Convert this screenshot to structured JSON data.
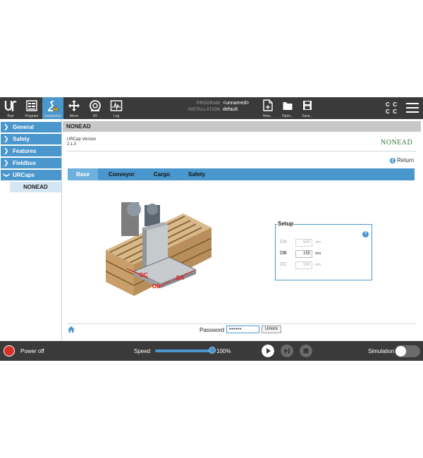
{
  "header": {
    "nav": [
      {
        "label": "Run",
        "icon": "ur-logo-icon"
      },
      {
        "label": "Program",
        "icon": "program-icon"
      },
      {
        "label": "Installation",
        "icon": "installation-icon",
        "active": true
      },
      {
        "label": "Move",
        "icon": "move-icon"
      },
      {
        "label": "I/O",
        "icon": "io-icon"
      },
      {
        "label": "Log",
        "icon": "log-icon"
      }
    ],
    "program_key": "PROGRAM",
    "program_value": "<unnamed>",
    "installation_key": "INSTALLATION",
    "installation_value": "default",
    "file_buttons": [
      {
        "label": "New...",
        "icon": "new-file-icon"
      },
      {
        "label": "Open...",
        "icon": "open-folder-icon"
      },
      {
        "label": "Save...",
        "icon": "save-icon"
      }
    ],
    "cc_glyph": "C"
  },
  "sidebar": {
    "items": [
      {
        "label": "General",
        "expanded": false
      },
      {
        "label": "Safety",
        "expanded": false
      },
      {
        "label": "Features",
        "expanded": false
      },
      {
        "label": "Fieldbus",
        "expanded": false
      },
      {
        "label": "URCaps",
        "expanded": true
      }
    ],
    "sub_item": "NONEAD"
  },
  "main": {
    "title": "NONEAD",
    "version_label": "URCap Version",
    "version_value": "2.1.0",
    "brand": "NONEAD",
    "return_label": "Return",
    "tabs": [
      {
        "label": "Base",
        "active": true
      },
      {
        "label": "Conveyor",
        "active": false
      },
      {
        "label": "Cargo",
        "active": false
      },
      {
        "label": "Safety",
        "active": false
      }
    ],
    "diagram_labels": {
      "dc": "DC",
      "db": "DB",
      "da": "DA"
    },
    "setup": {
      "title": "Setup",
      "help": "?",
      "fields": [
        {
          "label": "DA",
          "value": "600",
          "unit": "mm",
          "enabled": false
        },
        {
          "label": "DB",
          "value": "155",
          "unit": "mm",
          "enabled": true
        },
        {
          "label": "DC",
          "value": "590",
          "unit": "mm",
          "enabled": false
        }
      ]
    },
    "password_label": "Password",
    "password_value": "••••••",
    "unlock_label": "Unlock"
  },
  "footer": {
    "power_label": "Power off",
    "speed_label": "Speed",
    "speed_value": "100%",
    "speed_fraction": 1.0,
    "simulation_label": "Simulation",
    "simulation_on": false
  },
  "colors": {
    "accent": "#4a97cd",
    "header_bg": "#3a3a3a",
    "brand": "#2d7a3e",
    "power_red": "#d9302a"
  }
}
